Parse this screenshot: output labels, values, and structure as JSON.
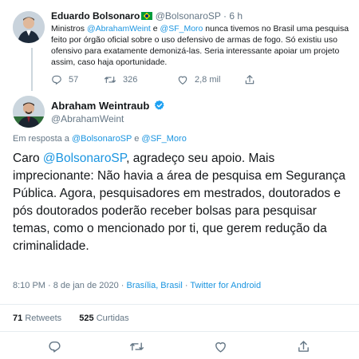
{
  "reply": {
    "author_name": "Eduardo Bolsonaro",
    "handle": "@BolsonaroSP",
    "separator": "·",
    "time": "6 h",
    "text_intro": "Ministros ",
    "mention1": "@AbrahamWeint",
    "text_and": " e ",
    "mention2": "@SF_Moro",
    "text_body": " nunca tivemos no Brasil uma pesquisa feito por órgão oficial sobre o uso defensivo de armas de fogo. Só existiu uso ofensivo para exatamente demonizá-las. Seria interessante apoiar um projeto assim, caso haja oportunidade.",
    "reply_count": "57",
    "retweet_count": "326",
    "like_count": "2,8 mil"
  },
  "main": {
    "author_name": "Abraham Weintraub",
    "handle": "@AbrahamWeint",
    "in_reply_prefix": "Em resposta a ",
    "in_reply_user1": "@BolsonaroSP",
    "in_reply_and": " e ",
    "in_reply_user2": "@SF_Moro",
    "text_start": "Caro ",
    "text_mention": "@BolsonaroSP",
    "text_rest": ", agradeço seu apoio. Mais imprecionante: Não havia a área de pesquisa em Segurança Pública. Agora, pesquisadores em mestrados, doutorados e pós doutorados poderão receber bolsas para pesquisar temas, como o mencionado por ti, que gerem redução da criminalidade.",
    "time": "8:10 PM",
    "date_sep": " · ",
    "date": "8 de jan de 2020",
    "location": "Brasília, Brasil",
    "client": "Twitter for Android",
    "retweets_count": "71",
    "retweets_label": "Retweets",
    "likes_count": "525",
    "likes_label": "Curtidas"
  },
  "colors": {
    "accent": "#1b95e0",
    "muted": "#657786",
    "text": "#14171a",
    "border": "#e6ecf0"
  },
  "icons": [
    "verified-badge-icon",
    "brazil-flag-icon",
    "reply-icon",
    "retweet-icon",
    "like-icon",
    "share-icon"
  ]
}
